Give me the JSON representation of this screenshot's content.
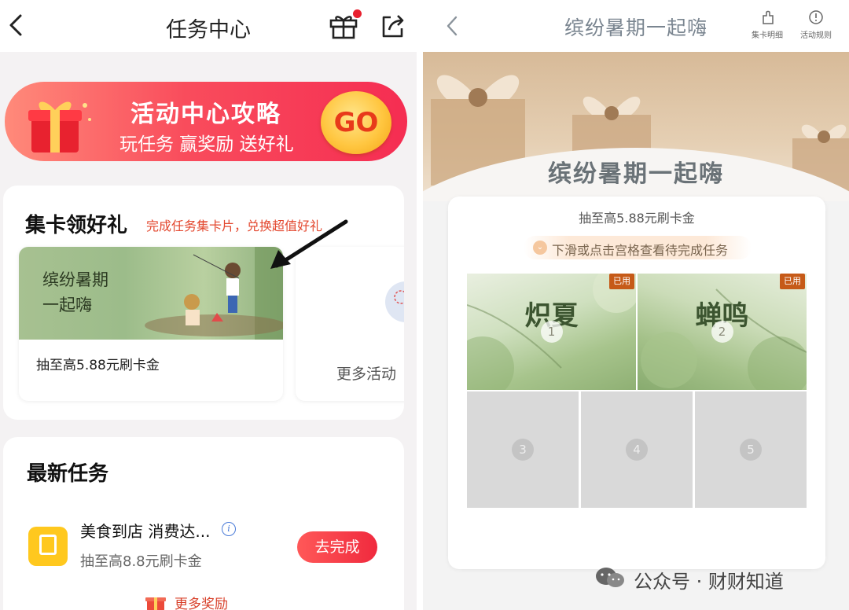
{
  "left": {
    "title": "任务中心",
    "banner": {
      "title": "活动中心攻略",
      "subtitle": "玩任务 赢奖励 送好礼",
      "go_label": "GO"
    },
    "card_collect": {
      "title": "集卡领好礼",
      "subtitle": "完成任务集卡片，兑换超值好礼",
      "activity": {
        "image_text_line1": "缤纷暑期",
        "image_text_line2": "一起嗨",
        "description": "抽至高5.88元刷卡金"
      },
      "more_label": "更多活动"
    },
    "latest_tasks": {
      "title": "最新任务",
      "task": {
        "name": "美食到店 消费达...",
        "reward": "抽至高8.8元刷卡金",
        "button": "去完成"
      },
      "more_rewards": "更多奖励"
    }
  },
  "right": {
    "title": "缤纷暑期一起嗨",
    "actions": [
      {
        "label": "集卡明细",
        "icon": "card-detail-icon"
      },
      {
        "label": "活动规则",
        "icon": "rules-icon"
      }
    ],
    "hero_title": "缤纷暑期一起嗨",
    "subtitle": "抽至高5.88元刷卡金",
    "hint": "下滑或点击宫格查看待完成任务",
    "tiles": [
      {
        "number": "1",
        "label": "炽夏",
        "tag": "已用"
      },
      {
        "number": "2",
        "label": "蝉鸣",
        "tag": "已用"
      },
      {
        "number": "3"
      },
      {
        "number": "4"
      },
      {
        "number": "5"
      }
    ]
  },
  "watermark": "公众号 · 财财知道",
  "colors": {
    "accent_red": "#f02a3e",
    "tag_orange": "#c65a18",
    "banner_gold": "#ffc640"
  }
}
